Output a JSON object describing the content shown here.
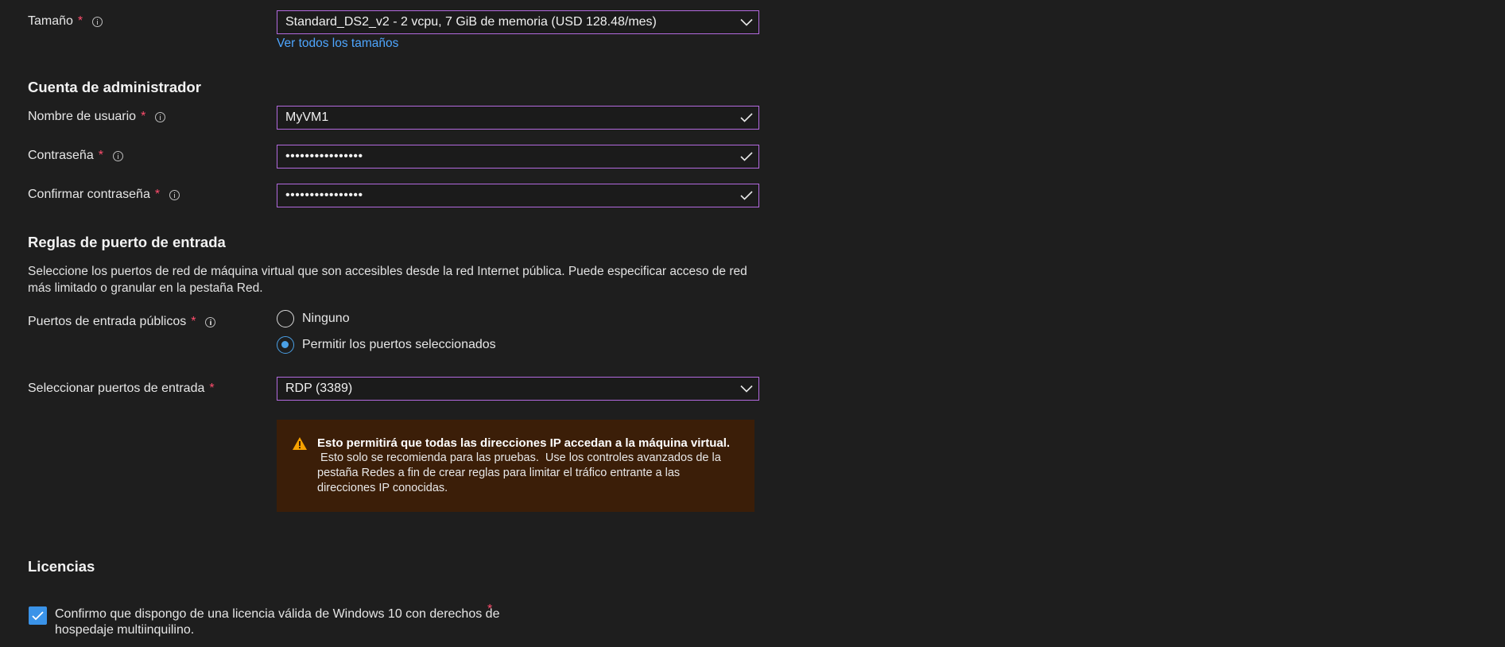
{
  "size": {
    "label": "Tamaño",
    "required_mark": "*",
    "value": "Standard_DS2_v2 - 2 vcpu, 7 GiB de memoria (USD 128.48/mes)",
    "see_all_link": "Ver todos los tamaños"
  },
  "admin": {
    "heading": "Cuenta de administrador",
    "username_label": "Nombre de usuario",
    "username_value": "MyVM1",
    "password_label": "Contraseña",
    "password_value": "••••••••••••••••",
    "confirm_label": "Confirmar contraseña",
    "confirm_value": "••••••••••••••••"
  },
  "inbound": {
    "heading": "Reglas de puerto de entrada",
    "description_line1": "Seleccione los puertos de red de máquina virtual que son accesibles desde la red Internet pública. Puede especificar acceso de red",
    "description_line2": "más limitado o granular en la pestaña Red.",
    "public_ports_label": "Puertos de entrada públicos",
    "options": [
      "Ninguno",
      "Permitir los puertos seleccionados"
    ],
    "selected_option": "Permitir los puertos seleccionados",
    "select_ports_label": "Seleccionar puertos de entrada",
    "select_ports_value": "RDP (3389)",
    "warning_title": "Esto permitirá que todas las direcciones IP accedan a la máquina virtual.",
    "warning_body": " Esto solo se recomienda para las pruebas.  Use los controles avanzados de la pestaña Redes a fin de crear reglas para limitar el tráfico entrante a las direcciones IP conocidas."
  },
  "licensing": {
    "heading": "Licencias",
    "confirm_text": "Confirmo que dispongo de una licencia válida de Windows 10 con derechos de hospedaje multiinquilino.",
    "checked": true,
    "required_mark": "*"
  },
  "colors": {
    "background": "#1e1e1e",
    "field_border": "#b36adf",
    "link": "#4ea6ff",
    "required": "#ff4d6d",
    "accent": "#3a93e8",
    "warning_bg": "#3b1e08",
    "warning_icon": "#f7a200"
  },
  "icons": {
    "info": "info-circle-icon",
    "dropdown": "chevron-down-icon",
    "valid": "checkmark-icon",
    "warning": "warning-triangle-icon"
  }
}
